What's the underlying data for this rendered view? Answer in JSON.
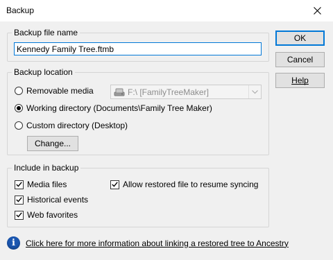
{
  "window": {
    "title": "Backup"
  },
  "backup_file": {
    "group_label": "Backup file name",
    "value": "Kennedy Family Tree.ftmb"
  },
  "buttons": {
    "ok": "OK",
    "cancel": "Cancel",
    "help": "Help"
  },
  "backup_location": {
    "group_label": "Backup location",
    "options": [
      {
        "label": "Removable media",
        "selected": false
      },
      {
        "label": "Working directory (Documents\\Family Tree Maker)",
        "selected": true
      },
      {
        "label": "Custom directory (Desktop)",
        "selected": false
      }
    ],
    "drive_combo": {
      "value": "F:\\  [FamilyTreeMaker]",
      "enabled": false
    },
    "change_button": "Change..."
  },
  "include": {
    "group_label": "Include in backup",
    "items": [
      {
        "label": "Media files",
        "checked": true
      },
      {
        "label": "Historical events",
        "checked": true
      },
      {
        "label": "Web favorites",
        "checked": true
      },
      {
        "label": "Allow restored file to resume syncing",
        "checked": true
      }
    ]
  },
  "info_link": "Click here for more information about linking a restored tree to Ancestry",
  "colors": {
    "accent": "#0078d7",
    "info_icon": "#1a56b0"
  }
}
